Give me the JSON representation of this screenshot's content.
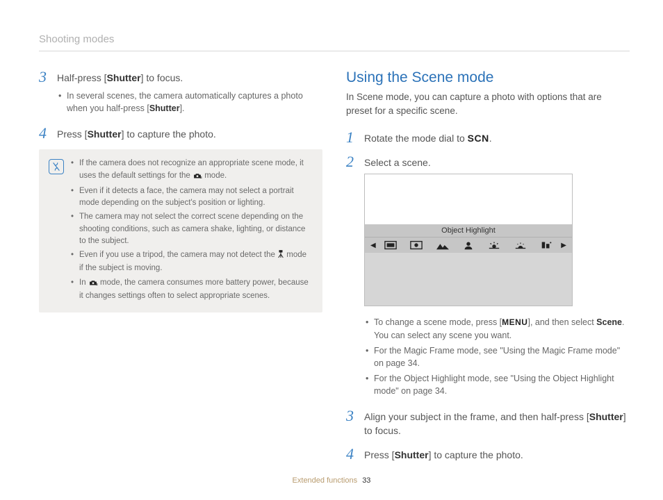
{
  "section_header": "Shooting modes",
  "left": {
    "step3": {
      "num": "3",
      "text_a": "Half-press [",
      "shutter": "Shutter",
      "text_b": "] to focus.",
      "bullets": [
        {
          "a": "In several scenes, the camera automatically captures a photo when you half-press [",
          "shutter": "Shutter",
          "b": "]."
        }
      ]
    },
    "step4": {
      "num": "4",
      "text_a": "Press [",
      "shutter": "Shutter",
      "text_b": "] to capture the photo."
    },
    "note": {
      "items": [
        {
          "a": "If the camera does not recognize an appropriate scene mode, it uses the default settings for the ",
          "icon": "cs-mode-icon",
          "b": " mode."
        },
        {
          "a": "Even if it detects a face, the camera may not select a portrait mode depending on the subject's position or lighting.",
          "icon": "",
          "b": ""
        },
        {
          "a": "The camera may not select the correct scene depending on the shooting conditions, such as camera shake, lighting, or distance to the subject.",
          "icon": "",
          "b": ""
        },
        {
          "a": "Even if you use a tripod, the camera may not detect the ",
          "icon": "tripod-icon",
          "b": " mode if the subject is moving."
        },
        {
          "a": "In ",
          "icon": "cs-mode-icon",
          "b": " mode, the camera consumes more battery power, because it changes settings often to select appropriate scenes."
        }
      ]
    }
  },
  "right": {
    "heading": "Using the Scene mode",
    "intro": "In Scene mode, you can capture a photo with options that are preset for a specific scene.",
    "step1": {
      "num": "1",
      "text_a": "Rotate the mode dial to ",
      "scn": "SCN",
      "text_b": "."
    },
    "step2": {
      "num": "2",
      "text": "Select a scene."
    },
    "screen_label": "Object Highlight",
    "step2_bullets": [
      {
        "a": "To change a scene mode, press [",
        "menu": "MENU",
        "b": "], and then select ",
        "bold": "Scene",
        "c": ". You can select any scene you want."
      },
      {
        "a": "For the Magic Frame mode, see \"Using the Magic Frame mode\" on page 34.",
        "menu": "",
        "b": "",
        "bold": "",
        "c": ""
      },
      {
        "a": "For the Object Highlight mode, see \"Using the Object Highlight mode\" on page 34.",
        "menu": "",
        "b": "",
        "bold": "",
        "c": ""
      }
    ],
    "step3": {
      "num": "3",
      "text_a": "Align your subject in the frame, and then half-press [",
      "shutter": "Shutter",
      "text_b": "] to focus."
    },
    "step4": {
      "num": "4",
      "text_a": "Press [",
      "shutter": "Shutter",
      "text_b": "] to capture the photo."
    }
  },
  "footer": {
    "label": "Extended functions",
    "page": "33"
  }
}
